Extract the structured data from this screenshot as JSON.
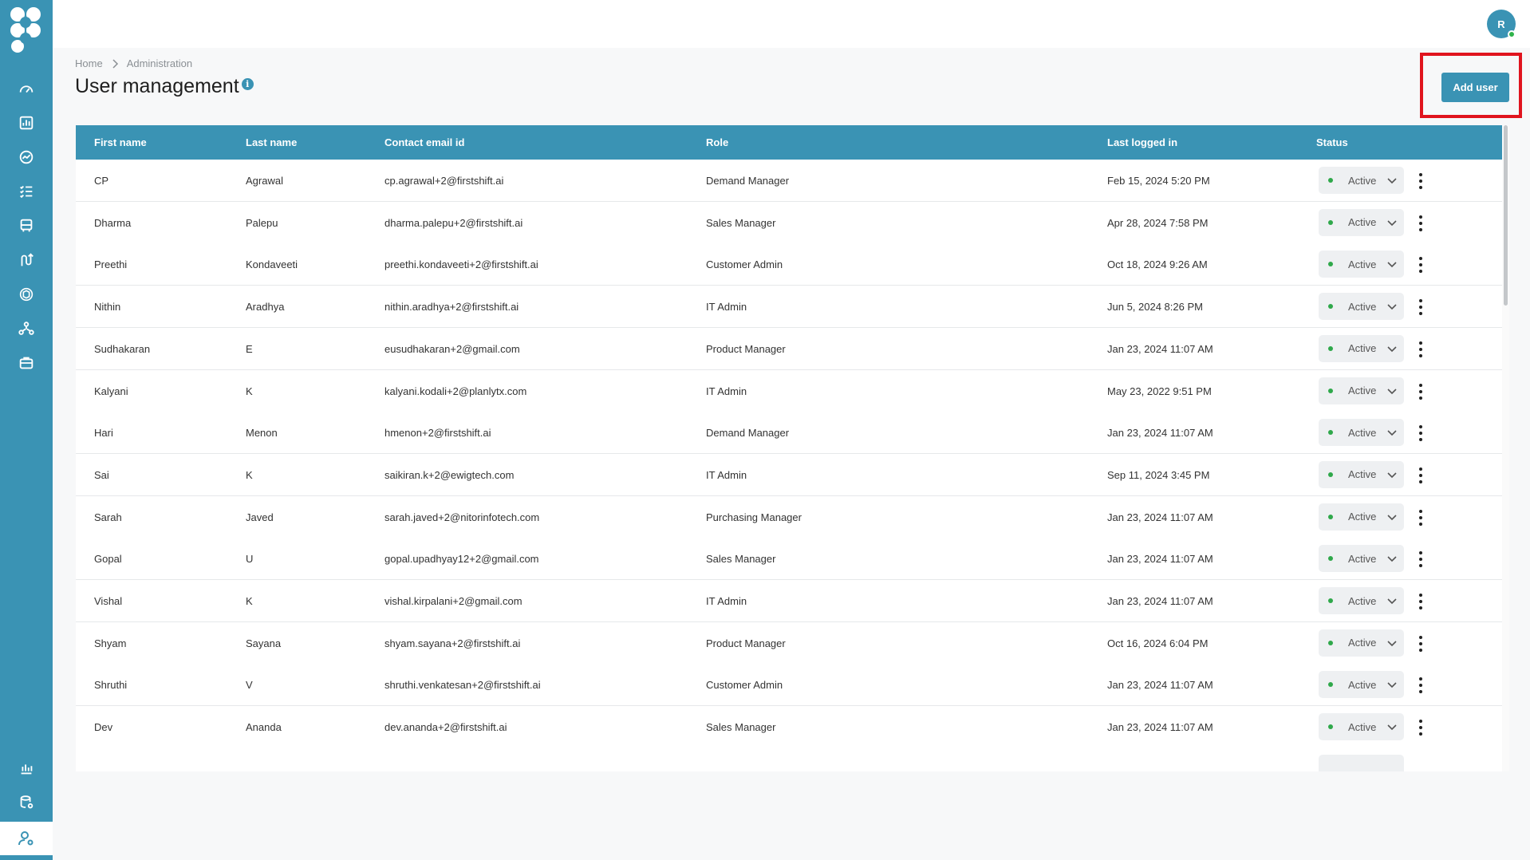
{
  "header": {
    "avatar_initial": "R",
    "breadcrumb": [
      "Home",
      "Administration"
    ],
    "title": "User management",
    "info_glyph": "i",
    "add_user_label": "Add user"
  },
  "sidebar": {
    "items": [
      "dashboard-icon",
      "reports-icon",
      "analytics-icon",
      "tasks-icon",
      "transport-icon",
      "routes-icon",
      "ai-icon",
      "network-icon",
      "briefcase-icon",
      "chart-icon",
      "database-settings-icon",
      "user-settings-icon"
    ],
    "active": "user-settings-icon"
  },
  "colors": {
    "primary": "#3a93b4",
    "highlight": "#e0141e",
    "active_dot": "#2fa84a"
  },
  "table": {
    "columns": [
      "First name",
      "Last name",
      "Contact email id",
      "Role",
      "Last logged in",
      "Status"
    ],
    "rows": [
      {
        "first": "CP",
        "last": "Agrawal",
        "email": "cp.agrawal+2@firstshift.ai",
        "role": "Demand Manager",
        "logged": "Feb 15, 2024 5:20 PM",
        "status": "Active"
      },
      {
        "first": "Dharma",
        "last": "Palepu",
        "email": "dharma.palepu+2@firstshift.ai",
        "role": "Sales Manager",
        "logged": "Apr 28, 2024 7:58 PM",
        "status": "Active"
      },
      {
        "first": "Preethi",
        "last": "Kondaveeti",
        "email": "preethi.kondaveeti+2@firstshift.ai",
        "role": "Customer Admin",
        "logged": "Oct 18, 2024 9:26 AM",
        "status": "Active"
      },
      {
        "first": "Nithin",
        "last": "Aradhya",
        "email": "nithin.aradhya+2@firstshift.ai",
        "role": "IT Admin",
        "logged": "Jun 5, 2024 8:26 PM",
        "status": "Active"
      },
      {
        "first": "Sudhakaran",
        "last": "E",
        "email": "eusudhakaran+2@gmail.com",
        "role": "Product Manager",
        "logged": "Jan 23, 2024 11:07 AM",
        "status": "Active"
      },
      {
        "first": "Kalyani",
        "last": "K",
        "email": "kalyani.kodali+2@planlytx.com",
        "role": "IT Admin",
        "logged": "May 23, 2022 9:51 PM",
        "status": "Active"
      },
      {
        "first": "Hari",
        "last": "Menon",
        "email": "hmenon+2@firstshift.ai",
        "role": "Demand Manager",
        "logged": "Jan 23, 2024 11:07 AM",
        "status": "Active"
      },
      {
        "first": "Sai",
        "last": "K",
        "email": "saikiran.k+2@ewigtech.com",
        "role": "IT Admin",
        "logged": "Sep 11, 2024 3:45 PM",
        "status": "Active"
      },
      {
        "first": "Sarah",
        "last": "Javed",
        "email": "sarah.javed+2@nitorinfotech.com",
        "role": "Purchasing Manager",
        "logged": "Jan 23, 2024 11:07 AM",
        "status": "Active"
      },
      {
        "first": "Gopal",
        "last": "U",
        "email": "gopal.upadhyay12+2@gmail.com",
        "role": "Sales Manager",
        "logged": "Jan 23, 2024 11:07 AM",
        "status": "Active"
      },
      {
        "first": "Vishal",
        "last": "K",
        "email": "vishal.kirpalani+2@gmail.com",
        "role": "IT Admin",
        "logged": "Jan 23, 2024 11:07 AM",
        "status": "Active"
      },
      {
        "first": "Shyam",
        "last": "Sayana",
        "email": "shyam.sayana+2@firstshift.ai",
        "role": "Product Manager",
        "logged": "Oct 16, 2024 6:04 PM",
        "status": "Active"
      },
      {
        "first": "Shruthi",
        "last": "V",
        "email": "shruthi.venkatesan+2@firstshift.ai",
        "role": "Customer Admin",
        "logged": "Jan 23, 2024 11:07 AM",
        "status": "Active"
      },
      {
        "first": "Dev",
        "last": "Ananda",
        "email": "dev.ananda+2@firstshift.ai",
        "role": "Sales Manager",
        "logged": "Jan 23, 2024 11:07 AM",
        "status": "Active"
      }
    ]
  }
}
